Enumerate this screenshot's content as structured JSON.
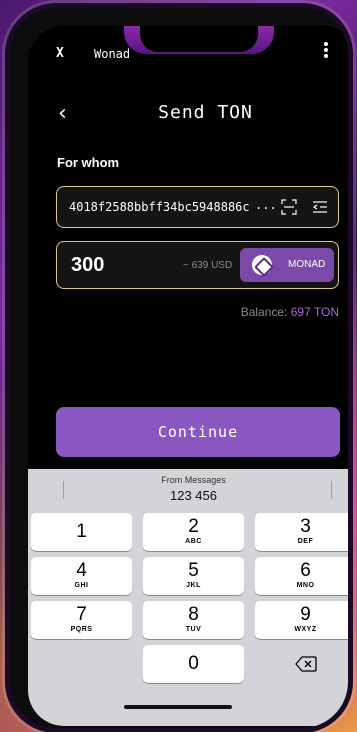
{
  "app": {
    "close_label": "X",
    "name": "Wonad"
  },
  "header": {
    "title": "Send TON",
    "back_icon": "chevron-left-icon"
  },
  "form": {
    "recipient_label": "For whom",
    "recipient_address": "4018f2588bbff34bc5948886c",
    "address_ellipsis": "...",
    "amount": "300",
    "amount_usd": "~ 639 USD",
    "token_label": "MONAD",
    "balance_label": "Balance:",
    "balance_value": "697 TON"
  },
  "continue_label": "Continue",
  "keyboard": {
    "suggestion_source": "From Messages",
    "suggestion_code": "123 456",
    "keys": [
      {
        "num": "1",
        "letters": ""
      },
      {
        "num": "2",
        "letters": "ABC"
      },
      {
        "num": "3",
        "letters": "DEF"
      },
      {
        "num": "4",
        "letters": "GHI"
      },
      {
        "num": "5",
        "letters": "JKL"
      },
      {
        "num": "6",
        "letters": "MNO"
      },
      {
        "num": "7",
        "letters": "PQRS"
      },
      {
        "num": "8",
        "letters": "TUV"
      },
      {
        "num": "9",
        "letters": "WXYZ"
      },
      {
        "num": "0",
        "letters": ""
      }
    ]
  },
  "colors": {
    "accent": "#8a56bf",
    "token_button": "#7b4aa8",
    "balance_value": "#a86ad8",
    "field_border": "#d9c98a"
  }
}
